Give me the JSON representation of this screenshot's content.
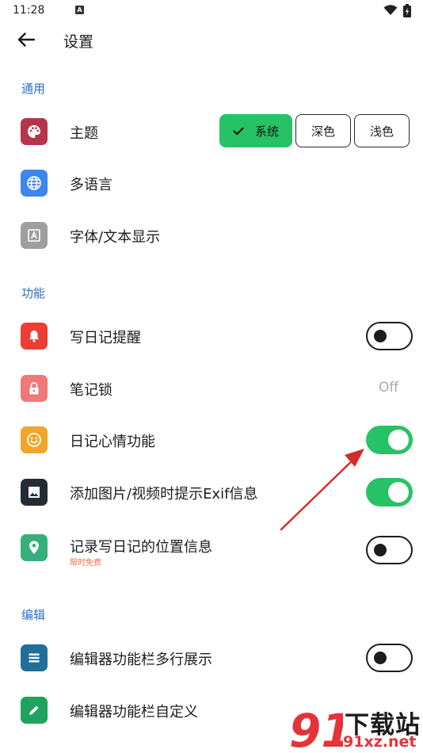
{
  "status_bar": {
    "time": "11:28",
    "notification_icon": "a-square-icon",
    "wifi_icon": "wifi-icon",
    "battery_icon": "battery-icon"
  },
  "app_bar": {
    "title": "设置",
    "back_icon": "arrow-left-icon"
  },
  "sections": {
    "general": "通用",
    "features": "功能",
    "editor": "编辑"
  },
  "rows": {
    "theme": {
      "label": "主题",
      "icon": "palette-icon",
      "color": "#b5364c"
    },
    "language": {
      "label": "多语言",
      "icon": "globe-icon",
      "color": "#3d86ef"
    },
    "font": {
      "label": "字体/文本显示",
      "icon": "font-a-icon",
      "color": "#9e9e9e"
    },
    "reminder": {
      "label": "写日记提醒",
      "icon": "bell-icon",
      "color": "#ec3e36",
      "toggle": false
    },
    "lock": {
      "label": "笔记锁",
      "icon": "lock-icon",
      "color": "#f07878",
      "value": "Off"
    },
    "mood": {
      "label": "日记心情功能",
      "icon": "smiley-icon",
      "color": "#f0a52b",
      "toggle": true
    },
    "exif": {
      "label": "添加图片/视频时提示Exif信息",
      "icon": "image-icon",
      "color": "#262c33",
      "toggle": true
    },
    "location": {
      "label": "记录写日记的位置信息",
      "sublabel": "限时免费",
      "icon": "location-pin-icon",
      "color": "#36b07a",
      "toggle": false
    },
    "toolbar_multiline": {
      "label": "编辑器功能栏多行展示",
      "icon": "list-icon",
      "color": "#1f6f99",
      "toggle": false
    },
    "toolbar_custom": {
      "label": "编辑器功能栏自定义",
      "icon": "pencil-icon",
      "color": "#1fa35e"
    }
  },
  "theme_options": [
    "系统",
    "深色",
    "浅色"
  ],
  "theme_selected": "系统",
  "colors": {
    "accent_green": "#27c265",
    "section_blue": "#2c6fc0",
    "annotation_red": "#d42a2a"
  },
  "watermark": {
    "top": "下载站",
    "bottom": "91xz.net",
    "logo": "91"
  }
}
